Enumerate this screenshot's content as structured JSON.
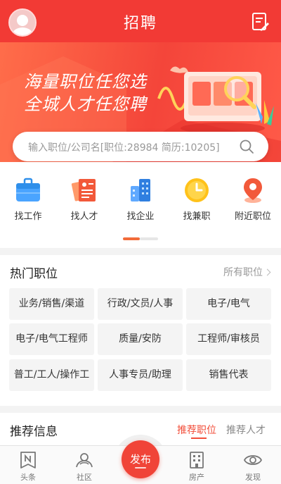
{
  "header": {
    "title": "招聘"
  },
  "banner": {
    "line1": "海量职位任您选",
    "line2": "全城人才任您聘"
  },
  "search": {
    "placeholder": "输入职位/公司名[职位:28984 简历:10205]"
  },
  "quick_links": [
    {
      "label": "找工作",
      "icon": "briefcase-icon"
    },
    {
      "label": "找人才",
      "icon": "resume-icon"
    },
    {
      "label": "找企业",
      "icon": "building-icon"
    },
    {
      "label": "找兼职",
      "icon": "clock-icon"
    },
    {
      "label": "附近职位",
      "icon": "location-pin-icon"
    }
  ],
  "hot_jobs": {
    "title": "热门职位",
    "all_link": "所有职位",
    "items": [
      "业务/销售/渠道",
      "行政/文员/人事",
      "电子/电气",
      "电子/电气工程师",
      "质量/安防",
      "工程师/审核员",
      "普工/工人/操作工",
      "人事专员/助理",
      "销售代表"
    ]
  },
  "recommend": {
    "title": "推荐信息",
    "tabs": [
      {
        "label": "推荐职位",
        "active": true
      },
      {
        "label": "推荐人才",
        "active": false
      }
    ]
  },
  "tabbar": {
    "items": [
      {
        "label": "头条",
        "icon": "news-icon"
      },
      {
        "label": "社区",
        "icon": "community-icon"
      },
      {
        "label": "房产",
        "icon": "building-icon"
      },
      {
        "label": "发现",
        "icon": "eye-icon"
      }
    ],
    "publish_label": "发布"
  },
  "colors": {
    "primary_red": "#f23a35",
    "accent_orange": "#f26b3a"
  }
}
